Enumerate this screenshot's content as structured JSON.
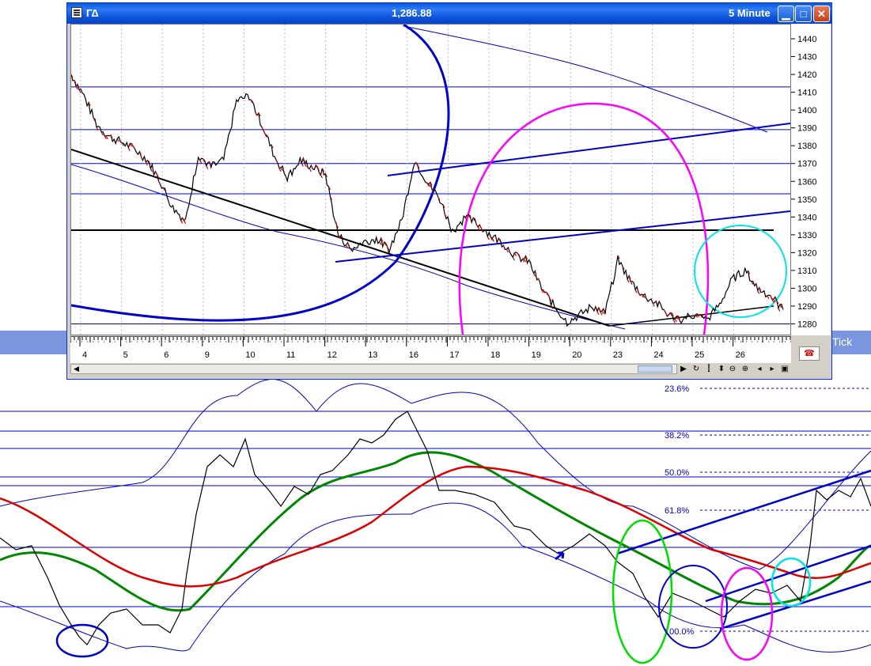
{
  "window": {
    "symbol": "ΓΔ",
    "last_price": "1,286.88",
    "interval": "5 Minute",
    "buttons": {
      "minimize_icon": "minimize-icon",
      "maximize_icon": "maximize-icon",
      "close_icon": "close-icon"
    }
  },
  "background_chart": {
    "tab_label": "Tick",
    "fib_levels": [
      "23.6%",
      "38.2%",
      "50.0%",
      "61.8%",
      "100.0%"
    ]
  },
  "chart_data": {
    "type": "line",
    "y_ticks": [
      "1440",
      "1430",
      "1420",
      "1410",
      "1400",
      "1390",
      "1380",
      "1370",
      "1360",
      "1350",
      "1340",
      "1330",
      "1320",
      "1310",
      "1300",
      "1290",
      "1280"
    ],
    "ylim": [
      1274,
      1448
    ],
    "x_ticks": [
      "4",
      "5",
      "6",
      "9",
      "10",
      "11",
      "12",
      "13",
      "16",
      "17",
      "18",
      "19",
      "20",
      "23",
      "24",
      "25",
      "26"
    ],
    "series": [
      {
        "values": [
          1420,
          1408,
          1392,
          1385,
          1382,
          1378,
          1372,
          1360,
          1345,
          1338,
          1375,
          1368,
          1372,
          1405,
          1408,
          1392,
          1374,
          1362,
          1372,
          1368,
          1364,
          1330,
          1322,
          1326,
          1328,
          1322,
          1338,
          1372,
          1360,
          1350,
          1332,
          1340,
          1336,
          1330,
          1325,
          1318,
          1315,
          1300,
          1290,
          1281,
          1285,
          1290,
          1286,
          1316,
          1304,
          1296,
          1292,
          1285,
          1283,
          1285,
          1282,
          1291,
          1305,
          1310,
          1300,
          1296,
          1288
        ]
      }
    ],
    "colors": {
      "price": "#000000",
      "down": "#cc0000",
      "trendlines": "#0000cc",
      "circle_pink": "#ff00ff",
      "circle_cyan": "#00e5e5",
      "circle_blue": "#0000cc"
    }
  },
  "toolbar_icons": [
    "scroll-left-icon",
    "scroll-right-icon",
    "reset-icon",
    "bars-icon",
    "move-icon",
    "zoom-out-icon",
    "zoom-in-icon",
    "prev-icon",
    "next-icon",
    "window-icon"
  ],
  "alert_icon": "phone-alert-icon"
}
